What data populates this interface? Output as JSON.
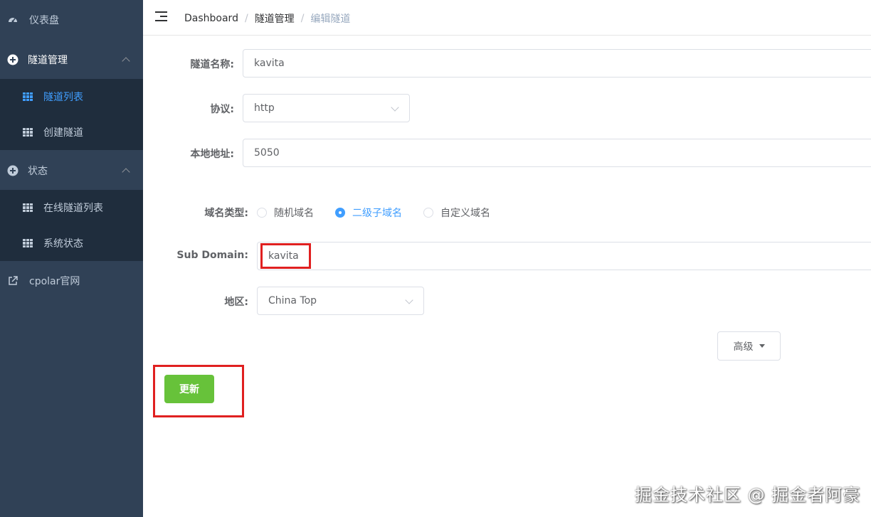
{
  "sidebar": {
    "dashboard": "仪表盘",
    "tunnel_mgmt": "隧道管理",
    "tunnel_list": "隧道列表",
    "create_tunnel": "创建隧道",
    "status": "状态",
    "online_tunnels": "在线隧道列表",
    "system_status": "系统状态",
    "cpolar_site": "cpolar官网"
  },
  "breadcrumb": {
    "item1": "Dashboard",
    "item2": "隧道管理",
    "item3": "编辑隧道",
    "separator": "/"
  },
  "form": {
    "name_label": "隧道名称:",
    "name_value": "kavita",
    "protocol_label": "协议:",
    "protocol_value": "http",
    "local_label": "本地地址:",
    "local_value": "5050",
    "domain_type_label": "域名类型:",
    "domain_options": [
      "随机域名",
      "二级子域名",
      "自定义域名"
    ],
    "domain_selected": "二级子域名",
    "subdomain_label": "Sub Domain:",
    "subdomain_value": "kavita",
    "region_label": "地区:",
    "region_value": "China Top",
    "advanced_label": "高级",
    "update_label": "更新"
  },
  "colors": {
    "sidebar_bg": "#304156",
    "submenu_bg": "#1f2d3d",
    "active": "#409eff",
    "success": "#67c23a",
    "highlight": "#e02020"
  },
  "watermark": "掘金技术社区 @ 掘金者阿豪"
}
